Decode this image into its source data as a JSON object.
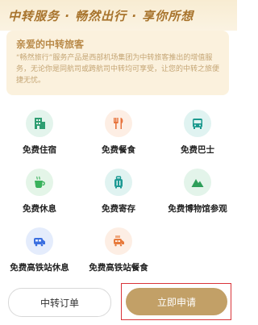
{
  "header": {
    "slogan": "中转服务 · 畅然出行 · 享你所想"
  },
  "intro": {
    "title": "亲爱的中转旅客",
    "text": "“畅然旅行”服务产品是西部机场集团为中转旅客推出的增值服务，无论你是同航司或跨航司中转均可享受，让您的中转之旅便捷无忧。"
  },
  "services": [
    {
      "label": "免费住宿",
      "icon": "hotel-icon",
      "color": "#2e9e72",
      "bg": "#e3f4ec"
    },
    {
      "label": "免费餐食",
      "icon": "dining-icon",
      "color": "#e7733c",
      "bg": "#fdeee4"
    },
    {
      "label": "免费巴士",
      "icon": "bus-icon",
      "color": "#1c9a8f",
      "bg": "#e0f3f1"
    },
    {
      "label": "免费休息",
      "icon": "coffee-icon",
      "color": "#39b25c",
      "bg": "#e4f5e8"
    },
    {
      "label": "免费寄存",
      "icon": "luggage-icon",
      "color": "#1d9a94",
      "bg": "#e0f3f1"
    },
    {
      "label": "免费博物馆参观",
      "icon": "mountain-icon",
      "color": "#2e9e5a",
      "bg": "#e3f4ea"
    },
    {
      "label": "免费高铁站休息",
      "icon": "train-rest-icon",
      "color": "#3b6fe0",
      "bg": "#e4ecfc"
    },
    {
      "label": "免费高铁站餐食",
      "icon": "train-dining-icon",
      "color": "#e77a3c",
      "bg": "#fdeee4"
    }
  ],
  "actions": {
    "orders_label": "中转订单",
    "apply_label": "立即申请"
  }
}
